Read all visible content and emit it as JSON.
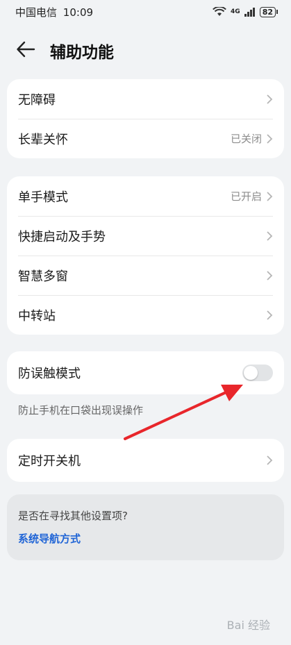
{
  "status": {
    "carrier": "中国电信",
    "time": "10:09",
    "network": "4G",
    "battery": "82"
  },
  "header": {
    "title": "辅助功能"
  },
  "group1": [
    {
      "label": "无障碍",
      "value": ""
    },
    {
      "label": "长辈关怀",
      "value": "已关闭"
    }
  ],
  "group2": [
    {
      "label": "单手模式",
      "value": "已开启"
    },
    {
      "label": "快捷启动及手势",
      "value": ""
    },
    {
      "label": "智慧多窗",
      "value": ""
    },
    {
      "label": "中转站",
      "value": ""
    }
  ],
  "toggle_row": {
    "label": "防误触模式",
    "state": "off"
  },
  "toggle_desc": "防止手机在口袋出现误操作",
  "scheduled": {
    "label": "定时开关机"
  },
  "hint": {
    "question": "是否在寻找其他设置项?",
    "link": "系统导航方式"
  },
  "annotation": {
    "arrow_color": "#e8262b"
  },
  "watermark": "Bai 经验"
}
